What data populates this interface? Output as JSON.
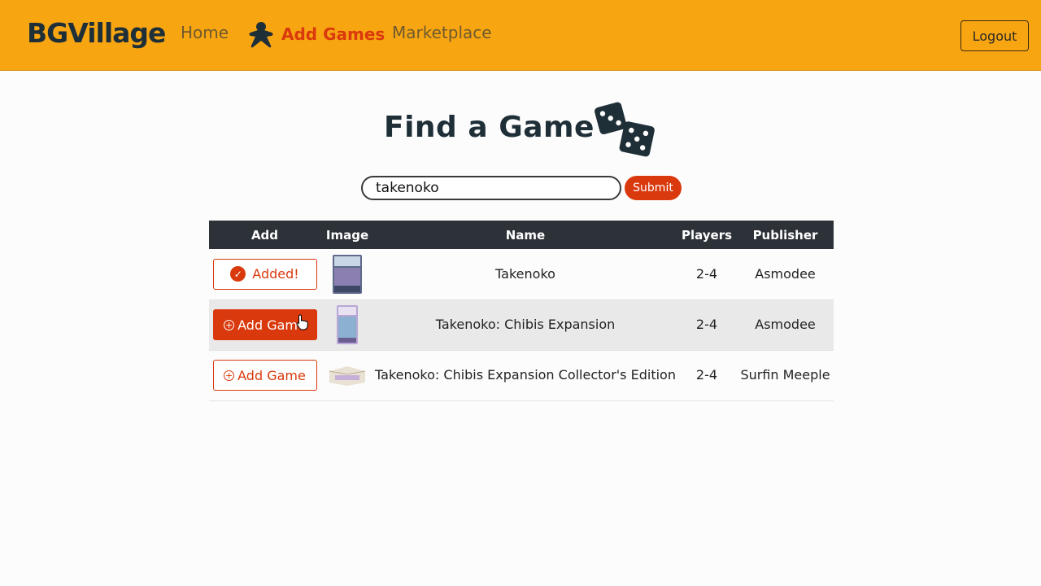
{
  "nav": {
    "brand": "BGVillage",
    "home": "Home",
    "add_games": "Add Games",
    "marketplace": "Marketplace",
    "logout": "Logout",
    "active_color": "#d9390c",
    "bar_color": "#f8a512"
  },
  "page": {
    "title": "Find a Game",
    "title_icon": "dice-icon"
  },
  "search": {
    "value": "takenoko",
    "submit_label": "Submit"
  },
  "table": {
    "headers": [
      "Add",
      "Image",
      "Name",
      "Players",
      "Publisher"
    ],
    "rows": [
      {
        "button": "Added!",
        "button_state": "added",
        "name": "Takenoko",
        "players": "2-4",
        "publisher": "Asmodee",
        "image_icon": "game-box-icon"
      },
      {
        "button": "Add Game",
        "button_state": "hover",
        "name": "Takenoko: Chibis Expansion",
        "players": "2-4",
        "publisher": "Asmodee",
        "image_icon": "game-box-icon"
      },
      {
        "button": "Add Game",
        "button_state": "default",
        "name": "Takenoko: Chibis Expansion Collector's Edition",
        "players": "2-4",
        "publisher": "Surfin Meeple",
        "image_icon": "game-box-icon"
      }
    ]
  }
}
